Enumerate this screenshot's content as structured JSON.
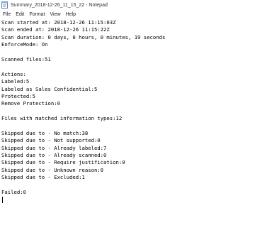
{
  "window": {
    "title": "Summary_2018-12-26_11_15_22 - Notepad",
    "icon": "notepad-icon"
  },
  "menu": {
    "items": [
      "File",
      "Edit",
      "Format",
      "View",
      "Help"
    ]
  },
  "editor": {
    "lines": [
      "Scan started at: 2018-12-26 11:15:03Z",
      "Scan ended at: 2018-12-26 11:15:22Z",
      "Scan duration: 0 days, 0 hours, 0 minutes, 19 seconds",
      "EnforceMode: On",
      "",
      "Scanned files:51",
      "",
      "Actions:",
      "Labeled:5",
      "Labeled as Sales Confidential:5",
      "Protected:5",
      "Remove Protection:0",
      "",
      "Files with matched information types:12",
      "",
      "Skipped due to - No match:38",
      "Skipped due to - Not supported:0",
      "Skipped due to - Already labeled:7",
      "Skipped due to - Already scanned:0",
      "Skipped due to - Require justification:0",
      "Skipped due to - Unknown reason:0",
      "Skipped due to - Excluded:1",
      "",
      "Failed:0",
      ""
    ]
  }
}
